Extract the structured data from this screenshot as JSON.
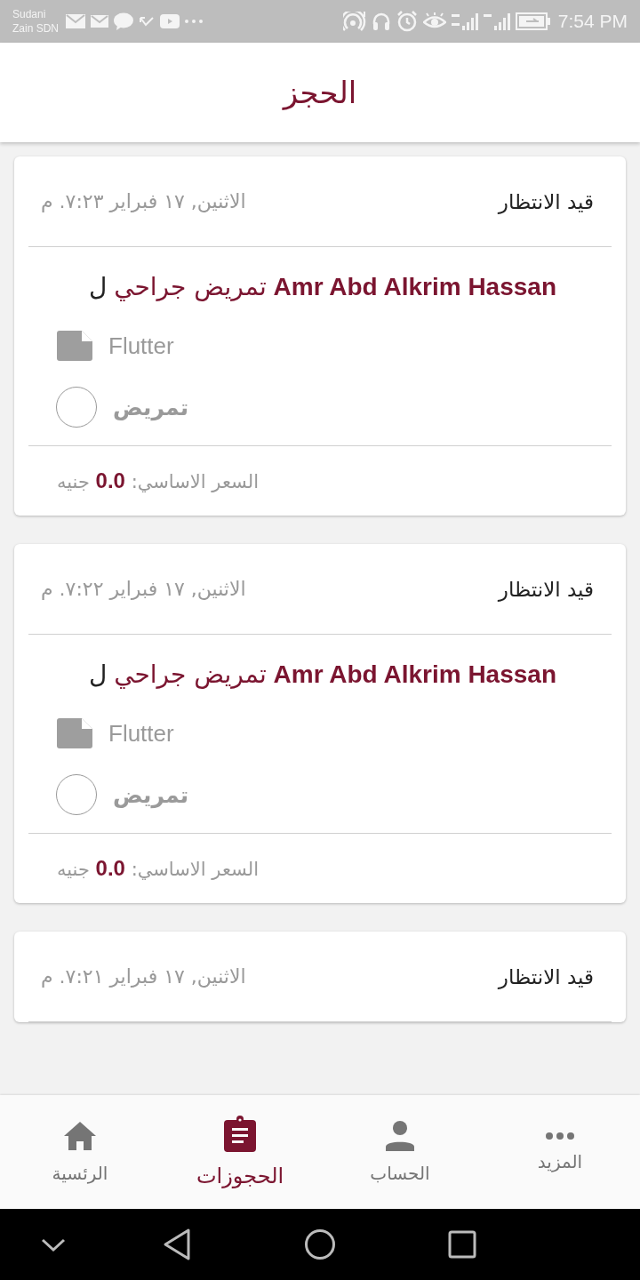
{
  "status_bar": {
    "carrier_line_1": "Sudani",
    "carrier_line_2": "Zain SDN",
    "time": "7:54 PM"
  },
  "app_bar": {
    "title": "الحجز"
  },
  "bookings": [
    {
      "status": "قيد الانتظار",
      "date": "الاثنين, ١٧ فبراير ٧:٢٣. م",
      "name": "Amr Abd Alkrim Hassan",
      "service": "تمريض جراحي",
      "prefix": "ل",
      "document": "Flutter",
      "category": "تمريض",
      "price": "السعر الاساسي: **0.0** جنيه"
    },
    {
      "status": "قيد الانتظار",
      "date": "الاثنين, ١٧ فبراير ٧:٢٢. م",
      "name": "Amr Abd Alkrim Hassan",
      "service": "تمريض جراحي",
      "prefix": "ل",
      "document": "Flutter",
      "category": "تمريض",
      "price": "السعر الاساسي: **0.0** جنيه"
    },
    {
      "status": "قيد الانتظار",
      "date": "الاثنين, ١٧ فبراير ٧:٢١. م"
    }
  ],
  "bottom_nav": [
    {
      "kind": "more",
      "label": "المزيد",
      "selected": false
    },
    {
      "kind": "account",
      "label": "الحساب",
      "selected": false
    },
    {
      "kind": "bookings",
      "label": "الحجوزات",
      "selected": true
    },
    {
      "kind": "home",
      "label": "الرئسية",
      "selected": false
    }
  ]
}
